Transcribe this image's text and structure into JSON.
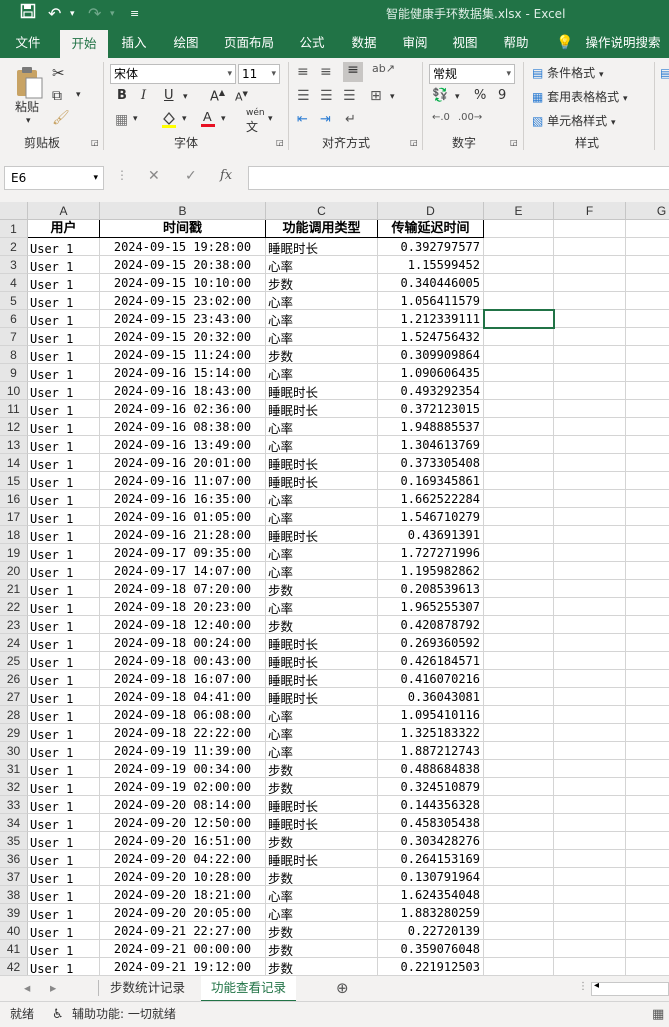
{
  "titlebar": {
    "save_icon": "save-icon",
    "undo_icon": "undo-icon",
    "redo_icon": "redo-icon",
    "customize_icon": "customize-qat-icon",
    "filename": "智能健康手环数据集.xlsx",
    "separator": "-",
    "app": "Excel"
  },
  "tabs": [
    "文件",
    "开始",
    "插入",
    "绘图",
    "页面布局",
    "公式",
    "数据",
    "审阅",
    "视图",
    "帮助",
    "操作说明搜索"
  ],
  "active_tab": "开始",
  "ribbon": {
    "clipboard": {
      "paste": "粘贴",
      "label": "剪贴板"
    },
    "font": {
      "name": "宋体",
      "size": "11",
      "bold": "B",
      "italic": "I",
      "underline": "U",
      "grow": "A",
      "shrink": "A",
      "wen": "wén",
      "label": "字体",
      "fill_color": "#ffff00",
      "font_color": "#e81123"
    },
    "alignment": {
      "label": "对齐方式"
    },
    "number": {
      "format": "常规",
      "percent": "%",
      "comma": "9",
      "label": "数字"
    },
    "styles": {
      "conditional": "条件格式",
      "table": "套用表格格式",
      "cell": "单元格样式",
      "label": "样式"
    }
  },
  "formula_bar": {
    "name_box": "E6",
    "cancel": "✕",
    "enter": "✓",
    "fx": "fx",
    "value": ""
  },
  "columns": [
    "A",
    "B",
    "C",
    "D",
    "E",
    "F",
    "G"
  ],
  "header_row": {
    "num": "1",
    "user": "用户",
    "time": "时间戳",
    "type": "功能调用类型",
    "latency": "传输延迟时间"
  },
  "rows": [
    {
      "num": "2",
      "user": "User_1",
      "time": "2024-09-15 19:28:00",
      "type": "睡眠时长",
      "latency": "0.392797577"
    },
    {
      "num": "3",
      "user": "User_1",
      "time": "2024-09-15 20:38:00",
      "type": "心率",
      "latency": "1.15599452"
    },
    {
      "num": "4",
      "user": "User_1",
      "time": "2024-09-15 10:10:00",
      "type": "步数",
      "latency": "0.340446005"
    },
    {
      "num": "5",
      "user": "User_1",
      "time": "2024-09-15 23:02:00",
      "type": "心率",
      "latency": "1.056411579"
    },
    {
      "num": "6",
      "user": "User_1",
      "time": "2024-09-15 23:43:00",
      "type": "心率",
      "latency": "1.212339111"
    },
    {
      "num": "7",
      "user": "User_1",
      "time": "2024-09-15 20:32:00",
      "type": "心率",
      "latency": "1.524756432"
    },
    {
      "num": "8",
      "user": "User_1",
      "time": "2024-09-15 11:24:00",
      "type": "步数",
      "latency": "0.309909864"
    },
    {
      "num": "9",
      "user": "User_1",
      "time": "2024-09-16 15:14:00",
      "type": "心率",
      "latency": "1.090606435"
    },
    {
      "num": "10",
      "user": "User_1",
      "time": "2024-09-16 18:43:00",
      "type": "睡眠时长",
      "latency": "0.493292354"
    },
    {
      "num": "11",
      "user": "User_1",
      "time": "2024-09-16 02:36:00",
      "type": "睡眠时长",
      "latency": "0.372123015"
    },
    {
      "num": "12",
      "user": "User_1",
      "time": "2024-09-16 08:38:00",
      "type": "心率",
      "latency": "1.948885537"
    },
    {
      "num": "13",
      "user": "User_1",
      "time": "2024-09-16 13:49:00",
      "type": "心率",
      "latency": "1.304613769"
    },
    {
      "num": "14",
      "user": "User_1",
      "time": "2024-09-16 20:01:00",
      "type": "睡眠时长",
      "latency": "0.373305408"
    },
    {
      "num": "15",
      "user": "User_1",
      "time": "2024-09-16 11:07:00",
      "type": "睡眠时长",
      "latency": "0.169345861"
    },
    {
      "num": "16",
      "user": "User_1",
      "time": "2024-09-16 16:35:00",
      "type": "心率",
      "latency": "1.662522284"
    },
    {
      "num": "17",
      "user": "User_1",
      "time": "2024-09-16 01:05:00",
      "type": "心率",
      "latency": "1.546710279"
    },
    {
      "num": "18",
      "user": "User_1",
      "time": "2024-09-16 21:28:00",
      "type": "睡眠时长",
      "latency": "0.43691391"
    },
    {
      "num": "19",
      "user": "User_1",
      "time": "2024-09-17 09:35:00",
      "type": "心率",
      "latency": "1.727271996"
    },
    {
      "num": "20",
      "user": "User_1",
      "time": "2024-09-17 14:07:00",
      "type": "心率",
      "latency": "1.195982862"
    },
    {
      "num": "21",
      "user": "User_1",
      "time": "2024-09-18 07:20:00",
      "type": "步数",
      "latency": "0.208539613"
    },
    {
      "num": "22",
      "user": "User_1",
      "time": "2024-09-18 20:23:00",
      "type": "心率",
      "latency": "1.965255307"
    },
    {
      "num": "23",
      "user": "User_1",
      "time": "2024-09-18 12:40:00",
      "type": "步数",
      "latency": "0.420878792"
    },
    {
      "num": "24",
      "user": "User_1",
      "time": "2024-09-18 00:24:00",
      "type": "睡眠时长",
      "latency": "0.269360592"
    },
    {
      "num": "25",
      "user": "User_1",
      "time": "2024-09-18 00:43:00",
      "type": "睡眠时长",
      "latency": "0.426184571"
    },
    {
      "num": "26",
      "user": "User_1",
      "time": "2024-09-18 16:07:00",
      "type": "睡眠时长",
      "latency": "0.416070216"
    },
    {
      "num": "27",
      "user": "User_1",
      "time": "2024-09-18 04:41:00",
      "type": "睡眠时长",
      "latency": "0.36043081"
    },
    {
      "num": "28",
      "user": "User_1",
      "time": "2024-09-18 06:08:00",
      "type": "心率",
      "latency": "1.095410116"
    },
    {
      "num": "29",
      "user": "User_1",
      "time": "2024-09-18 22:22:00",
      "type": "心率",
      "latency": "1.325183322"
    },
    {
      "num": "30",
      "user": "User_1",
      "time": "2024-09-19 11:39:00",
      "type": "心率",
      "latency": "1.887212743"
    },
    {
      "num": "31",
      "user": "User_1",
      "time": "2024-09-19 00:34:00",
      "type": "步数",
      "latency": "0.488684838"
    },
    {
      "num": "32",
      "user": "User_1",
      "time": "2024-09-19 02:00:00",
      "type": "步数",
      "latency": "0.324510879"
    },
    {
      "num": "33",
      "user": "User_1",
      "time": "2024-09-20 08:14:00",
      "type": "睡眠时长",
      "latency": "0.144356328"
    },
    {
      "num": "34",
      "user": "User_1",
      "time": "2024-09-20 12:50:00",
      "type": "睡眠时长",
      "latency": "0.458305438"
    },
    {
      "num": "35",
      "user": "User_1",
      "time": "2024-09-20 16:51:00",
      "type": "步数",
      "latency": "0.303428276"
    },
    {
      "num": "36",
      "user": "User_1",
      "time": "2024-09-20 04:22:00",
      "type": "睡眠时长",
      "latency": "0.264153169"
    },
    {
      "num": "37",
      "user": "User_1",
      "time": "2024-09-20 10:28:00",
      "type": "步数",
      "latency": "0.130791964"
    },
    {
      "num": "38",
      "user": "User_1",
      "time": "2024-09-20 18:21:00",
      "type": "心率",
      "latency": "1.624354048"
    },
    {
      "num": "39",
      "user": "User_1",
      "time": "2024-09-20 20:05:00",
      "type": "心率",
      "latency": "1.883280259"
    },
    {
      "num": "40",
      "user": "User_1",
      "time": "2024-09-21 22:27:00",
      "type": "步数",
      "latency": "0.22720139"
    },
    {
      "num": "41",
      "user": "User_1",
      "time": "2024-09-21 00:00:00",
      "type": "步数",
      "latency": "0.359076048"
    },
    {
      "num": "42",
      "user": "User_1",
      "time": "2024-09-21 19:12:00",
      "type": "步数",
      "latency": "0.221912503"
    }
  ],
  "sheets": [
    "步数统计记录",
    "功能查看记录"
  ],
  "active_sheet": "功能查看记录",
  "status": {
    "ready": "就绪",
    "accessibility": "辅助功能: 一切就绪"
  }
}
